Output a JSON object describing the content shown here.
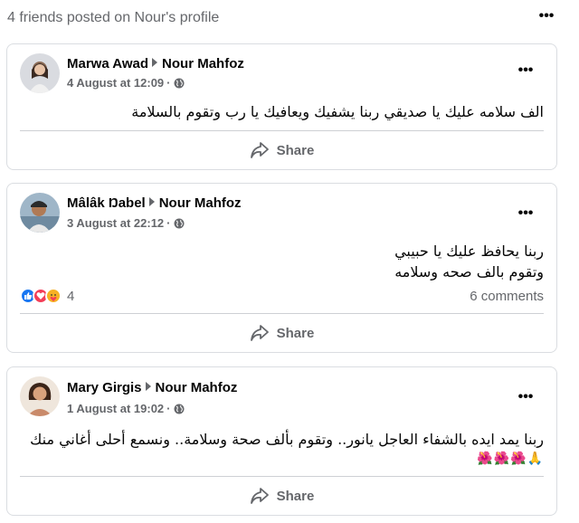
{
  "group": {
    "title": "4 friends posted on Nour's profile"
  },
  "posts": [
    {
      "author": "Marwa Awad",
      "target": "Nour Mahfoz",
      "date": "4 August at 12:09",
      "separator": "·",
      "text_lines": [
        "الف سلامه عليك يا صديقي ربنا يشفيك ويعافيك يا رب وتقوم بالسلامة"
      ],
      "share_label": "Share",
      "avatar_icon": "person-photo"
    },
    {
      "author": "Mâlâk Ŋabel",
      "target": "Nour Mahfoz",
      "date": "3 August at 22:12",
      "separator": "·",
      "text_lines": [
        "ربنا يحافظ عليك يا حبيبي",
        "وتقوم بالف صحه وسلامه"
      ],
      "reaction_count": "4",
      "comments": "6 comments",
      "share_label": "Share",
      "reaction_icons": [
        "like-icon",
        "love-icon",
        "care-icon"
      ],
      "avatar_icon": "person-photo"
    },
    {
      "author": "Mary Girgis",
      "target": "Nour Mahfoz",
      "date": "1 August at 19:02",
      "separator": "·",
      "text_lines": [
        "ربنا يمد ايده بالشفاء العاجل يانور.. وتقوم بألف صحة وسلامة.. ونسمع أحلى أغاني منك"
      ],
      "emojis": "🌺🌺🌺🙏",
      "share_label": "Share",
      "avatar_icon": "person-photo"
    }
  ],
  "colors": {
    "secondary_text": "#65676b",
    "primary_text": "#050505",
    "border": "#dadde1",
    "like_blue": "#1877f2",
    "love_red": "#f33e58",
    "care_yellow": "#f7b125"
  }
}
